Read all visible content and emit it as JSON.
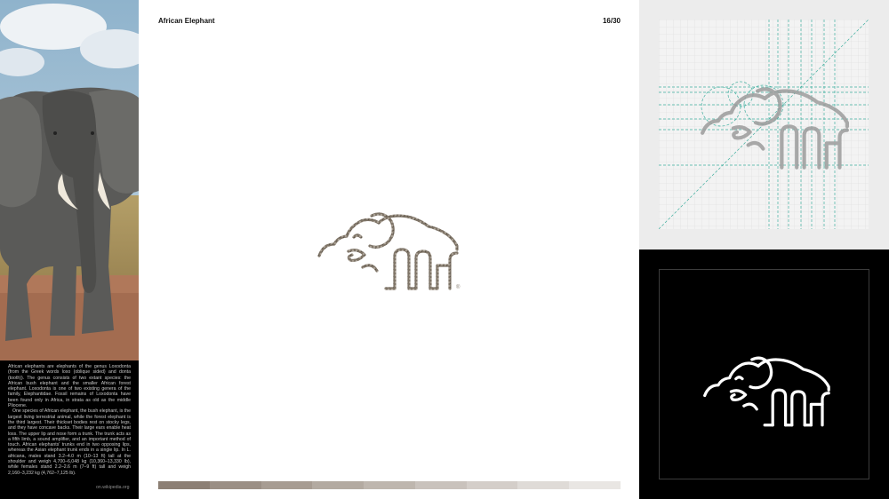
{
  "header": {
    "title": "African Elephant",
    "page_indicator": "16/30"
  },
  "description": {
    "paragraphs": [
      "African elephants are elephants of the genus Loxodonta (from the Greek words loxo (oblique sided) and donta (tooth)). The genus consists of two extant species: the African bush elephant and the smaller African forest elephant. Loxodonta is one of two existing genera of the family, Elephantidae. Fossil remains of Loxodonta have been found only in Africa, in strata as old as the middle Pliocene.",
      "One species of African elephant, the bush elephant, is the largest living terrestrial animal, while the forest elephant is the third largest. Their thickset bodies rest on stocky legs, and they have concave backs. Their large ears enable heat loss. The upper lip and nose form a trunk. The trunk acts as a fifth limb, a sound amplifier, and an important method of touch. African elephants' trunks end in two opposing lips, whereas the Asian elephant trunk ends in a single lip. In L. africana, males stand 3.2–4.0 m (10–13 ft) tall at the shoulder and weigh 4,700–6,048 kg (10,360–13,330 lb), while females stand 2.2–2.6 m (7–9 ft) tall and weigh 2,160–3,232 kg (4,762–7,125 lb)."
    ],
    "source": "on.wikipedia.org"
  },
  "icons": {
    "registered": "registered-mark-icon",
    "logo": "elephant-logo-icon"
  },
  "colors": {
    "logo_texture": "#7d7466",
    "grid_guides": "#3fae9e",
    "dark_panel": "#000000",
    "light_panel": "#ececec",
    "swatches": [
      "#8c7f74",
      "#9b8f85",
      "#a79c92",
      "#b3aaa1",
      "#beb6ae",
      "#c9c2bc",
      "#d4cec9",
      "#dfdbd7",
      "#e9e6e3"
    ]
  }
}
